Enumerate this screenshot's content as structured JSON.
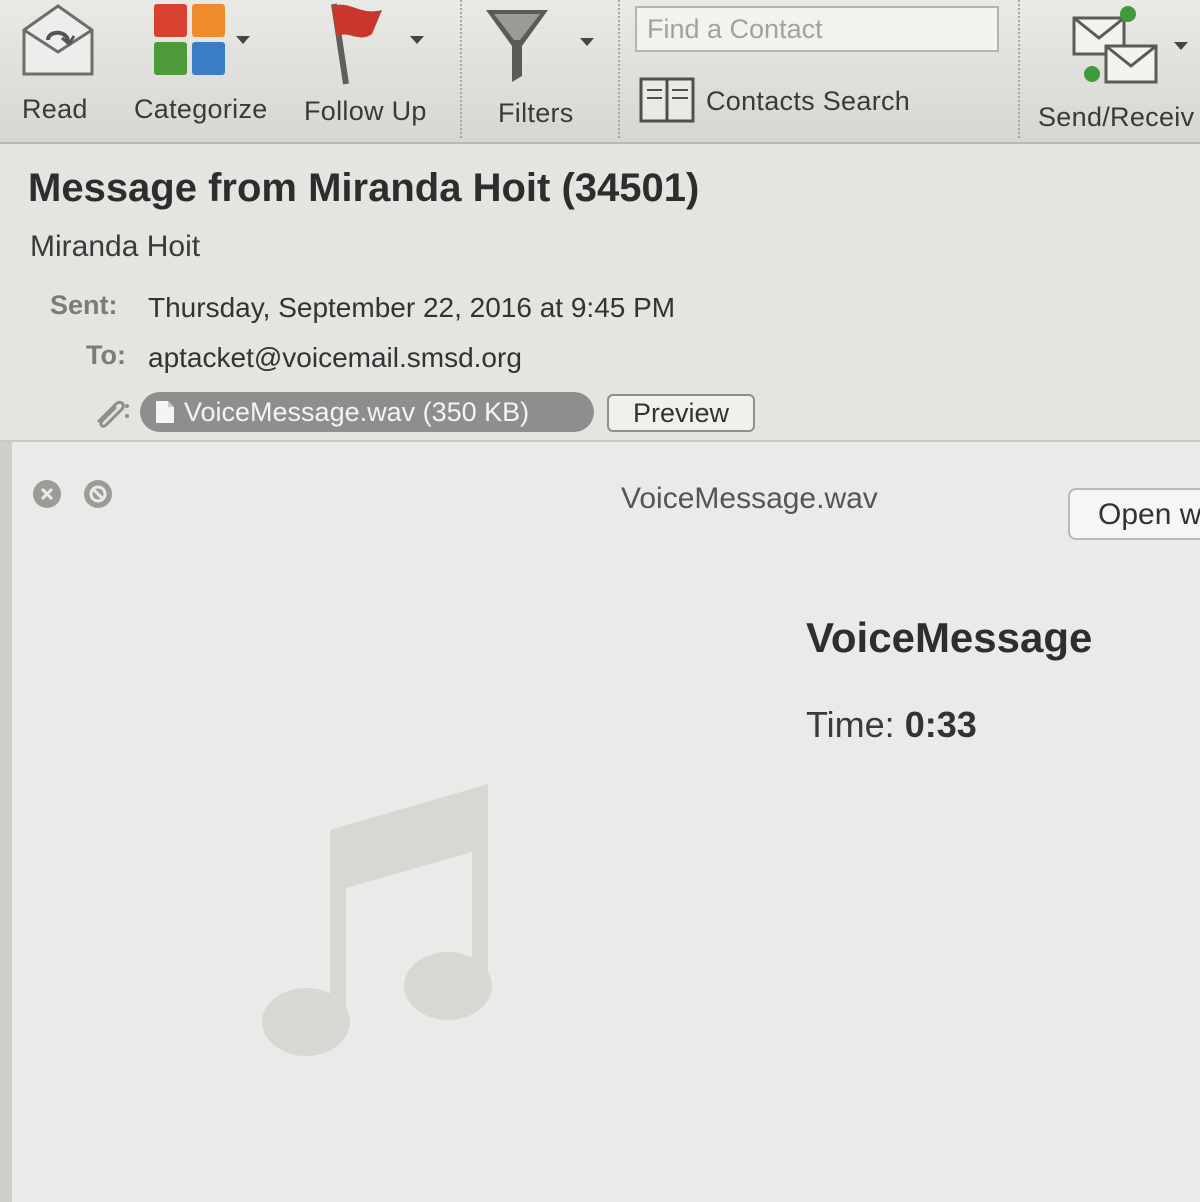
{
  "toolbar": {
    "read_label": "Read",
    "categorize_label": "Categorize",
    "follow_up_label": "Follow Up",
    "filters_label": "Filters",
    "contacts_search_label": "Contacts Search",
    "send_receive_label": "Send/Receiv",
    "find_contact_placeholder": "Find a Contact"
  },
  "message": {
    "subject": "Message from Miranda Hoit (34501)",
    "from": "Miranda Hoit",
    "sent_label": "Sent:",
    "sent_value": "Thursday, September 22, 2016 at 9:45 PM",
    "to_label": "To:",
    "to_value": "aptacket@voicemail.smsd.org",
    "attachment": "VoiceMessage.wav (350 KB)",
    "preview_label": "Preview"
  },
  "quicklook": {
    "title": "VoiceMessage.wav",
    "open_label": "Open w",
    "file_name": "VoiceMessage",
    "time_label": "Time:",
    "time_value": "0:33"
  },
  "colors": {
    "category_red": "#d8412f",
    "category_orange": "#ee8b2c",
    "category_green": "#4d9a3a",
    "category_blue": "#3b7dc4",
    "flag_red": "#c9362c",
    "attachment_pill": "#8e8e8c"
  },
  "icons": [
    "envelope-read-icon",
    "category-grid-icon",
    "red-flag-icon",
    "funnel-icon",
    "address-book-icon",
    "send-receive-icon",
    "paperclip-icon",
    "document-icon",
    "close-icon",
    "stop-icon",
    "music-note-icon"
  ]
}
